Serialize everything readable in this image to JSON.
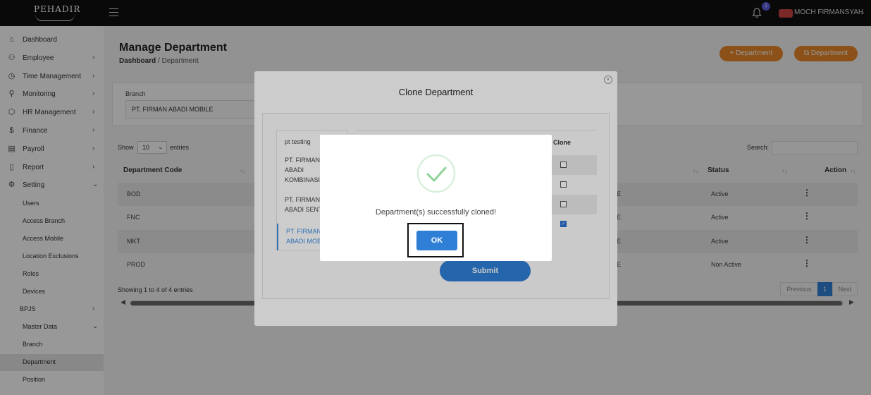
{
  "app": {
    "logo_text": "PEHADIR"
  },
  "topbar": {
    "notif_count": "1",
    "user_name": "MOCH FIRMANSYAH"
  },
  "sidebar": {
    "items": [
      {
        "label": "Dashboard",
        "icon": "dashboard-icon",
        "glyph": "⌂"
      },
      {
        "label": "Employee",
        "icon": "employee-icon",
        "glyph": "⚇"
      },
      {
        "label": "Time Management",
        "icon": "clock-icon",
        "glyph": "◷"
      },
      {
        "label": "Monitoring",
        "icon": "location-pin-icon",
        "glyph": "⚲"
      },
      {
        "label": "HR Management",
        "icon": "box-icon",
        "glyph": "⬡"
      },
      {
        "label": "Finance",
        "icon": "dollar-icon",
        "glyph": "$"
      },
      {
        "label": "Payroll",
        "icon": "payroll-icon",
        "glyph": "▤"
      },
      {
        "label": "Report",
        "icon": "document-icon",
        "glyph": "▯"
      },
      {
        "label": "Setting",
        "icon": "gear-icon",
        "glyph": "⚙"
      }
    ],
    "sub_items": [
      "Users",
      "Access Branch",
      "Access Mobile",
      "Location Exclusions",
      "Roles",
      "Devices",
      "BPJS",
      "Master Data",
      "Branch",
      "Department",
      "Position"
    ]
  },
  "page": {
    "title": "Manage Department",
    "breadcrumb_root": "Dashboard",
    "breadcrumb_sep": "/",
    "breadcrumb_current": "Department",
    "add_button": "+ Department",
    "clone_button": "⧉ Department",
    "branch_label": "Branch",
    "branch_value": "PT. FIRMAN ABADI MOBILE",
    "show_label": "Show",
    "show_value": "10",
    "entries_label": "entries",
    "search_label": "Search:",
    "col_code": "Department Code",
    "col_status": "Status",
    "col_action": "Action",
    "rows": [
      {
        "code": "BOD",
        "e": "E",
        "status": "Active"
      },
      {
        "code": "FNC",
        "e": "E",
        "status": "Active"
      },
      {
        "code": "MKT",
        "e": "E",
        "status": "Active"
      },
      {
        "code": "PROD",
        "e": "E",
        "status": "Non Active"
      }
    ],
    "showing": "Showing 1 to 4 of 4 entries",
    "pager_prev": "Previous",
    "pager_current": "1",
    "pager_next": "Next"
  },
  "clone_modal": {
    "title": "Clone Department",
    "branches": [
      {
        "line1": "pt testing",
        "line2": "",
        "line3": ""
      },
      {
        "line1": "PT. FIRMAN",
        "line2": "ABADI",
        "line3": "KOMBINASI"
      },
      {
        "line1": "PT. FIRMAN",
        "line2": "ABADI SENT",
        "line3": ""
      },
      {
        "line1": "PT. FIRMAN",
        "line2": "ABADI MOB",
        "line3": ""
      }
    ],
    "clone_header": "Clone",
    "checks": [
      false,
      false,
      false,
      true
    ],
    "submit": "Submit"
  },
  "alert": {
    "message": "Department(s) successfully cloned!",
    "ok": "OK",
    "success_color": "#8fd39a"
  }
}
